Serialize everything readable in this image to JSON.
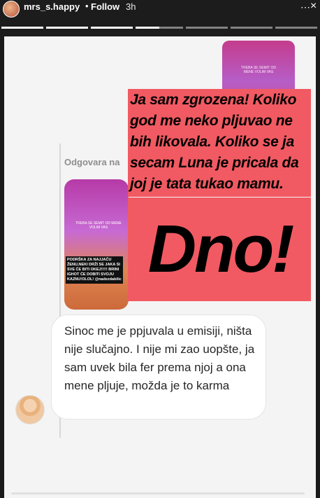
{
  "header": {
    "username": "mrs_s.happy",
    "separator": "•",
    "follow_label": "Follow",
    "time": "3h",
    "more_icon": "more-horizontal-icon",
    "close_icon": "close-icon"
  },
  "story": {
    "reply_label": "Odgovara na",
    "annotation_text": "Ja sam zgrozena! Koliko god me neko pljuvao ne bih likovala. Koliko se ja secam Luna je pricala da joj je tata tukao mamu.",
    "annotation_big": "Dno!",
    "message_text": "Sinoc me je ppjuvala u emisiji, ništa nije slučajno. I nije mi zao uopšte, ja sam uvek bila fer prema njoj a ona mene pljuje, možda je to karma",
    "thumb_caption": "PODRŠKA ZA NAJJAČU ŽENU,NEKI DRŽI SE JAKA SI SVE ĆE BITI OKEJ!!!!! BRINI IGHOT ĆE DOBITI SVOJU KAZNU!OLOL! @nadezdakilic",
    "thumb_small_text": "TREBA SE SEMIT OD MENE VOLIM VAS"
  },
  "colors": {
    "accent_red": "#f15a62",
    "background": "#f4f4f4"
  }
}
